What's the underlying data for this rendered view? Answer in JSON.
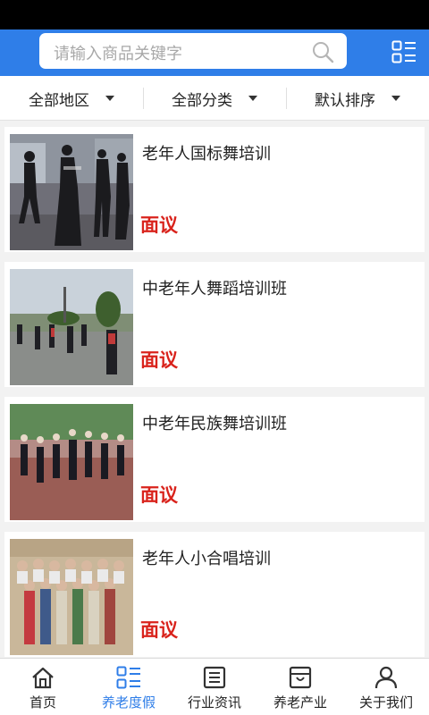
{
  "search": {
    "placeholder": "请输入商品关键字"
  },
  "filters": [
    {
      "label": "全部地区"
    },
    {
      "label": "全部分类"
    },
    {
      "label": "默认排序"
    }
  ],
  "items": [
    {
      "title": "老年人国标舞培训",
      "price": "面议"
    },
    {
      "title": "中老年人舞蹈培训班",
      "price": "面议"
    },
    {
      "title": "中老年民族舞培训班",
      "price": "面议"
    },
    {
      "title": "老年人小合唱培训",
      "price": "面议"
    }
  ],
  "tabs": [
    {
      "label": "首页",
      "icon": "home-icon"
    },
    {
      "label": "养老度假",
      "icon": "list-icon",
      "active": true
    },
    {
      "label": "行业资讯",
      "icon": "news-icon"
    },
    {
      "label": "养老产业",
      "icon": "store-icon"
    },
    {
      "label": "关于我们",
      "icon": "user-icon"
    }
  ],
  "colors": {
    "accent": "#2f7ee8",
    "price": "#d9231c"
  }
}
